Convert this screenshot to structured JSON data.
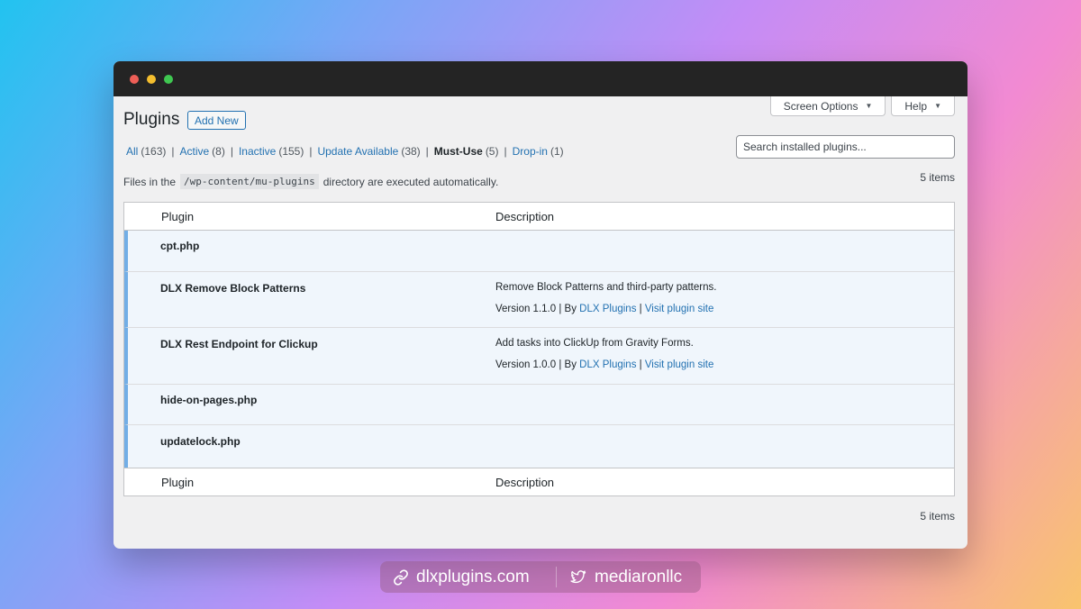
{
  "header": {
    "page_title": "Plugins",
    "add_new_label": "Add New",
    "screen_options_label": "Screen Options",
    "help_label": "Help"
  },
  "filters": [
    {
      "label": "All",
      "count": "(163)",
      "current": false
    },
    {
      "label": "Active",
      "count": "(8)",
      "current": false
    },
    {
      "label": "Inactive",
      "count": "(155)",
      "current": false
    },
    {
      "label": "Update Available",
      "count": "(38)",
      "current": false
    },
    {
      "label": "Must-Use",
      "count": "(5)",
      "current": true
    },
    {
      "label": "Drop-in",
      "count": "(1)",
      "current": false
    }
  ],
  "search": {
    "placeholder": "Search installed plugins..."
  },
  "items_count": "5 items",
  "notice": {
    "before": "Files in the",
    "code": "/wp-content/mu-plugins",
    "after": "directory are executed automatically."
  },
  "table": {
    "col_plugin": "Plugin",
    "col_description": "Description",
    "rows": [
      {
        "name": "cpt.php"
      },
      {
        "name": "DLX Remove Block Patterns",
        "description": "Remove Block Patterns and third-party patterns.",
        "version": "Version 1.1.0",
        "by": "By",
        "author": "DLX Plugins",
        "site": "Visit plugin site"
      },
      {
        "name": "DLX Rest Endpoint for Clickup",
        "description": "Add tasks into ClickUp from Gravity Forms.",
        "version": "Version 1.0.0",
        "by": "By",
        "author": "DLX Plugins",
        "site": "Visit plugin site"
      },
      {
        "name": "hide-on-pages.php"
      },
      {
        "name": "updatelock.php"
      }
    ]
  },
  "footer": {
    "website": "dlxplugins.com",
    "twitter": "mediaronllc",
    "link_icon": "link-icon",
    "twitter_icon": "twitter-bird-icon"
  },
  "colors": {
    "accent": "#2271b1",
    "row_highlight": "#f0f6fc",
    "row_border": "#72aee6",
    "titlebar": "#242424"
  }
}
